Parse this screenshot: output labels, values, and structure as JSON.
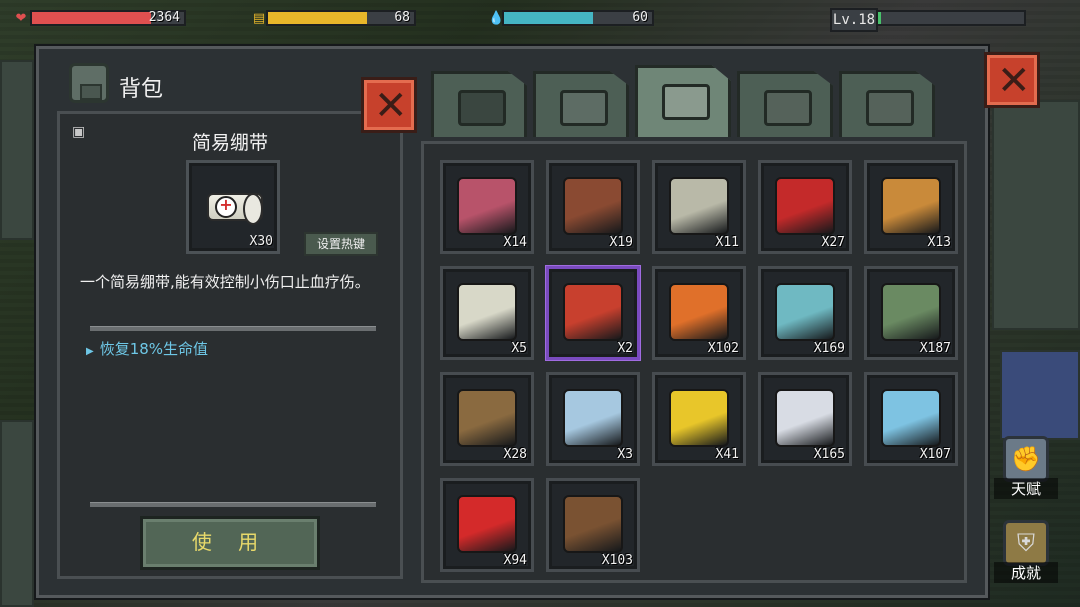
{
  "hud": {
    "health": {
      "value": "2364",
      "fraction": 0.78,
      "color": "#e05050"
    },
    "hunger": {
      "value": "68",
      "fraction": 0.68,
      "color": "#e8b62a"
    },
    "thirst": {
      "value": "60",
      "fraction": 0.6,
      "color": "#45b5c4"
    },
    "level": {
      "label": "Lv.18",
      "fraction": 0.02,
      "color": "#48c26b"
    }
  },
  "window": {
    "title": "背包",
    "tabs": [
      {
        "name": "backpack",
        "active": false
      },
      {
        "name": "medical",
        "active": false
      },
      {
        "name": "food",
        "active": true
      },
      {
        "name": "weapons",
        "active": false
      },
      {
        "name": "tools",
        "active": false
      }
    ]
  },
  "detail": {
    "item_name": "简易绷带",
    "count": "X30",
    "hotkey_label": "设置热键",
    "description": "一个简易绷带,能有效控制小伤口止血疗伤。",
    "effect": "恢复18%生命值",
    "use_label": "使 用"
  },
  "inventory": [
    {
      "item": "raw-meat",
      "count": "X14",
      "color": "#b8536a"
    },
    {
      "item": "steak",
      "count": "X19",
      "color": "#8a4a32"
    },
    {
      "item": "bean-can",
      "count": "X11",
      "color": "#b9b9a8"
    },
    {
      "item": "apples",
      "count": "X27",
      "color": "#c42a2a"
    },
    {
      "item": "burger",
      "count": "X13",
      "color": "#c98a3a"
    },
    {
      "item": "rice-bowl",
      "count": "X5",
      "color": "#d8d8c8"
    },
    {
      "item": "stew",
      "count": "X2",
      "color": "#c8402e",
      "rare": true
    },
    {
      "item": "carrots",
      "count": "X102",
      "color": "#e0702a"
    },
    {
      "item": "water-bucket",
      "count": "X169",
      "color": "#6fb9c2"
    },
    {
      "item": "dirty-water-bucket",
      "count": "X187",
      "color": "#6a8a62"
    },
    {
      "item": "grain-sack",
      "count": "X28",
      "color": "#8a6a40"
    },
    {
      "item": "water-jar",
      "count": "X3",
      "color": "#a6c8e0"
    },
    {
      "item": "chips-bag",
      "count": "X41",
      "color": "#e8c62a"
    },
    {
      "item": "salt-bag",
      "count": "X165",
      "color": "#d8dce4"
    },
    {
      "item": "water-bottle",
      "count": "X107",
      "color": "#7ec3e2"
    },
    {
      "item": "cola-can",
      "count": "X94",
      "color": "#d42a2a"
    },
    {
      "item": "chocolate-bar",
      "count": "X103",
      "color": "#7a5232"
    }
  ],
  "side": {
    "talent_label": "天赋",
    "achievement_label": "成就"
  }
}
